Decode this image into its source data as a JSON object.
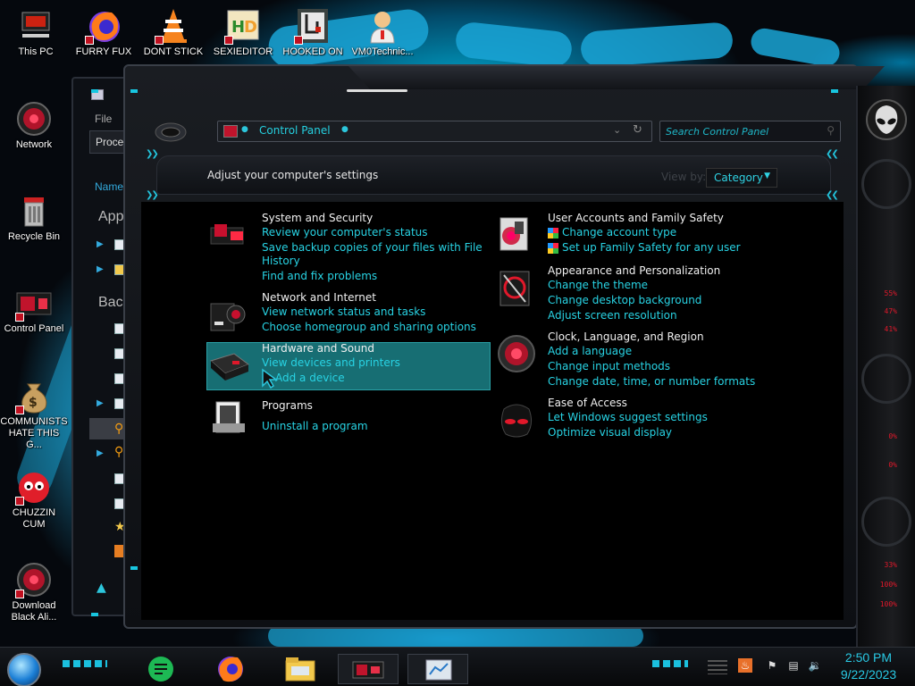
{
  "desktop": {
    "icons": [
      {
        "name": "this-pc-icon",
        "label": "This PC"
      },
      {
        "name": "firefox-shortcut-icon",
        "label": "FURRY FUX"
      },
      {
        "name": "vlc-shortcut-icon",
        "label": "DONT STICK"
      },
      {
        "name": "hex-editor-shortcut-icon",
        "label": "SEXIEDITOR"
      },
      {
        "name": "hooked-on-shortcut-icon",
        "label": "HOOKED ON"
      },
      {
        "name": "vm0-technician-shortcut-icon",
        "label": "VM0Technic..."
      },
      {
        "name": "network-icon",
        "label": "Network"
      },
      {
        "name": "recycle-bin-icon",
        "label": "Recycle Bin"
      },
      {
        "name": "control-panel-shortcut-icon",
        "label": "Control Panel"
      },
      {
        "name": "money-bag-shortcut-icon",
        "label": "COMMUNISTS HATE THIS G..."
      },
      {
        "name": "chuzzle-shortcut-icon",
        "label": "CHUZZIN CUM"
      },
      {
        "name": "download-shortcut-icon",
        "label": "Download Black Ali..."
      }
    ]
  },
  "bg_window": {
    "menu_file": "File",
    "tab_processes": "Proces",
    "col_name": "Name",
    "group_apps": "Apps",
    "group_background": "Back"
  },
  "window": {
    "address": {
      "crumb": "Control Panel"
    },
    "search": {
      "placeholder": "Search Control Panel"
    },
    "header": {
      "title": "Adjust your computer's settings",
      "view_by_label": "View by:",
      "view_by_value": "Category"
    }
  },
  "categories": {
    "system": {
      "title": "System and Security",
      "links": [
        "Review your computer's status",
        "Save backup copies of your files with File",
        "History",
        "Find and fix problems"
      ]
    },
    "network": {
      "title": "Network and Internet",
      "links": [
        "View network status and tasks",
        "Choose homegroup and sharing options"
      ]
    },
    "hardware": {
      "title": "Hardware and Sound",
      "links": [
        "View devices and printers",
        "Add a device"
      ]
    },
    "programs": {
      "title": "Programs",
      "links": [
        "Uninstall a program"
      ]
    },
    "accounts": {
      "title": "User Accounts and Family Safety",
      "links": [
        "Change account type",
        "Set up Family Safety for any user"
      ]
    },
    "appearance": {
      "title": "Appearance and Personalization",
      "links": [
        "Change the theme",
        "Change desktop background",
        "Adjust screen resolution"
      ]
    },
    "clock": {
      "title": "Clock, Language, and Region",
      "links": [
        "Add a language",
        "Change input methods",
        "Change date, time, or number formats"
      ]
    },
    "ease": {
      "title": "Ease of Access",
      "links": [
        "Let Windows suggest settings",
        "Optimize visual display"
      ]
    }
  },
  "gauges": {
    "values": [
      "55%",
      "47%",
      "41%",
      "0%",
      "0%",
      "33%",
      "100%",
      "100%"
    ]
  },
  "taskbar": {
    "time": "2:50 PM",
    "date": "9/22/2023"
  },
  "colors": {
    "link": "#28d3e4",
    "accent_red": "#e0182a",
    "hover": "#1a7a80"
  }
}
